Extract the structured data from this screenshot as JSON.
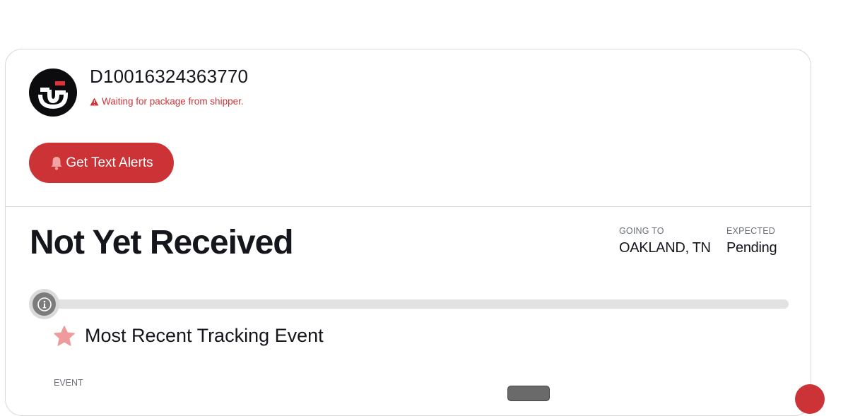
{
  "shipment": {
    "tracking_number": "D10016324363770",
    "status_message": "Waiting for package from shipper."
  },
  "actions": {
    "text_alerts_label": "Get Text Alerts"
  },
  "status": {
    "title": "Not Yet Received",
    "going_to_label": "GOING TO",
    "going_to_value": "OAKLAND, TN",
    "expected_label": "EXPECTED",
    "expected_value": "Pending",
    "progress": 0
  },
  "recent_event": {
    "heading": "Most Recent Tracking Event",
    "event_label": "EVENT"
  },
  "icons": {
    "logo": "carrier-logo",
    "warning": "warning-icon",
    "bell": "bell-icon",
    "info": "info-icon",
    "star": "star-icon"
  },
  "colors": {
    "accent": "#cb3336",
    "warning_text": "#cc3438",
    "track": "#e2e2e2"
  }
}
